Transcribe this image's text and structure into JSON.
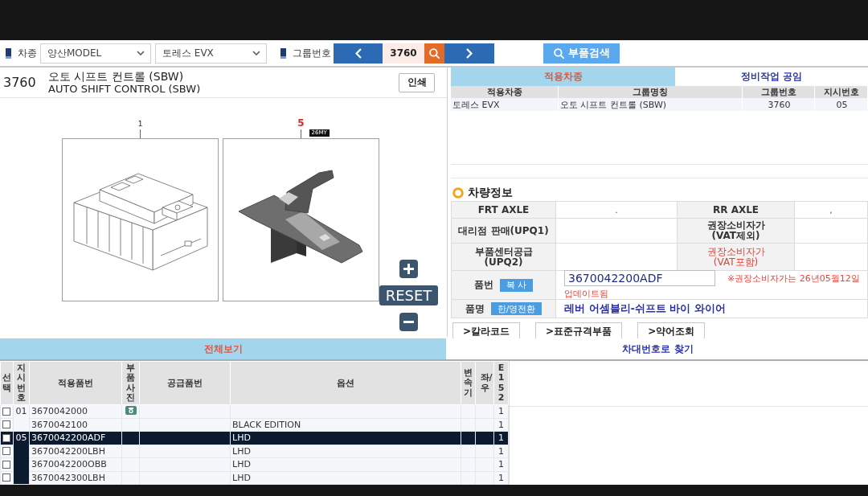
{
  "toolbar": {
    "vehicle_label": "차종",
    "model_select": "양산MODEL",
    "vehicle_select": "토레스 EVX",
    "group_label": "그룹번호",
    "group_number": "3760",
    "search_button": "부품검색"
  },
  "group_header": {
    "number": "3760",
    "title_ko": "오토 시프트 컨트롤 (SBW)",
    "title_en": "AUTO SHIFT CONTROL (SBW)",
    "print_button": "인쇄"
  },
  "diagram": {
    "parts": [
      {
        "callout": "1",
        "highlighted": false,
        "kind": "module"
      },
      {
        "callout": "5",
        "highlighted": true,
        "tag": "26MY",
        "kind": "lever"
      }
    ],
    "reset_button": "RESET"
  },
  "applicability": {
    "tabs": [
      {
        "label": "적용차종",
        "selected": true
      },
      {
        "label": "정비작업 공임",
        "selected": false
      }
    ],
    "columns": [
      "적용차종",
      "그룹명칭",
      "그룹번호",
      "지시번호"
    ],
    "rows": [
      [
        "토레스 EVX",
        "오토 시프트 컨트롤 (SBW)",
        "3760",
        "05"
      ]
    ]
  },
  "vehicle_info": {
    "title": "차량정보",
    "rows": [
      {
        "kind": "pair",
        "cells": [
          {
            "label": "FRT AXLE",
            "value": ".",
            "highlighted": false
          },
          {
            "label": "RR AXLE",
            "value": ",",
            "highlighted": false
          }
        ]
      },
      {
        "kind": "pair",
        "cells": [
          {
            "label": "대리점 판매(UPQ1)",
            "highlighted": false
          },
          {
            "label": "권장소비자가\n(VAT제외)",
            "highlighted": false
          }
        ]
      },
      {
        "kind": "pair",
        "cells": [
          {
            "label": "부품센터공급\n(UPQ2)",
            "highlighted": false
          },
          {
            "label": "권장소비자가\n(VAT포함)",
            "highlighted": true
          }
        ]
      },
      {
        "kind": "part_number",
        "label": "품번",
        "button": "복 사",
        "value": "3670042200ADF",
        "note": "※권장소비자가는 26년05월12일",
        "note_continued": "업데이트됨"
      },
      {
        "kind": "product_name",
        "label": "품명",
        "button": "한/영전환",
        "value": "레버 어셈블리-쉬프트 바이 와이어"
      }
    ]
  },
  "links": [
    ">칼라코드",
    ">표준규격부품",
    ">약어조회"
  ],
  "bottom_tabs": [
    {
      "label": "전체보기",
      "selected": true
    },
    {
      "label": "차대번호로 찾기",
      "selected": false
    }
  ],
  "parts_table": {
    "columns": [
      {
        "label": "선택",
        "vertical": true
      },
      {
        "label": "지시번호",
        "vertical": true
      },
      {
        "label": "적용품번",
        "vertical": false
      },
      {
        "label": "부품사진",
        "vertical": true
      },
      {
        "label": "공급품번",
        "vertical": false
      },
      {
        "label": "옵션",
        "vertical": false
      },
      {
        "label": "변속기",
        "vertical": true
      },
      {
        "label": "좌/우",
        "vertical": true
      },
      {
        "label": "E152",
        "vertical": true
      }
    ],
    "groups": [
      {
        "instruction_no": "01",
        "selected": false,
        "rows": [
          {
            "checked": false,
            "selected": false,
            "part_no": "3670042000",
            "photo": true,
            "e152": "1"
          },
          {
            "checked": false,
            "selected": false,
            "part_no": "3670042100",
            "photo": false,
            "option": "BLACK EDITION",
            "e152": "1"
          }
        ]
      },
      {
        "instruction_no": "05",
        "selected": true,
        "rows": [
          {
            "checked": false,
            "selected": true,
            "part_no": "3670042200ADF",
            "photo": false,
            "option": "LHD",
            "e152": "1"
          },
          {
            "checked": false,
            "selected": false,
            "part_no": "3670042200LBH",
            "photo": false,
            "option": "LHD",
            "e152": "1"
          },
          {
            "checked": false,
            "selected": false,
            "part_no": "3670042200OBB",
            "photo": false,
            "option": "LHD",
            "e152": "1"
          },
          {
            "checked": false,
            "selected": false,
            "part_no": "3670042300LBH",
            "photo": false,
            "option": "LHD",
            "e152": "1"
          }
        ]
      }
    ]
  }
}
